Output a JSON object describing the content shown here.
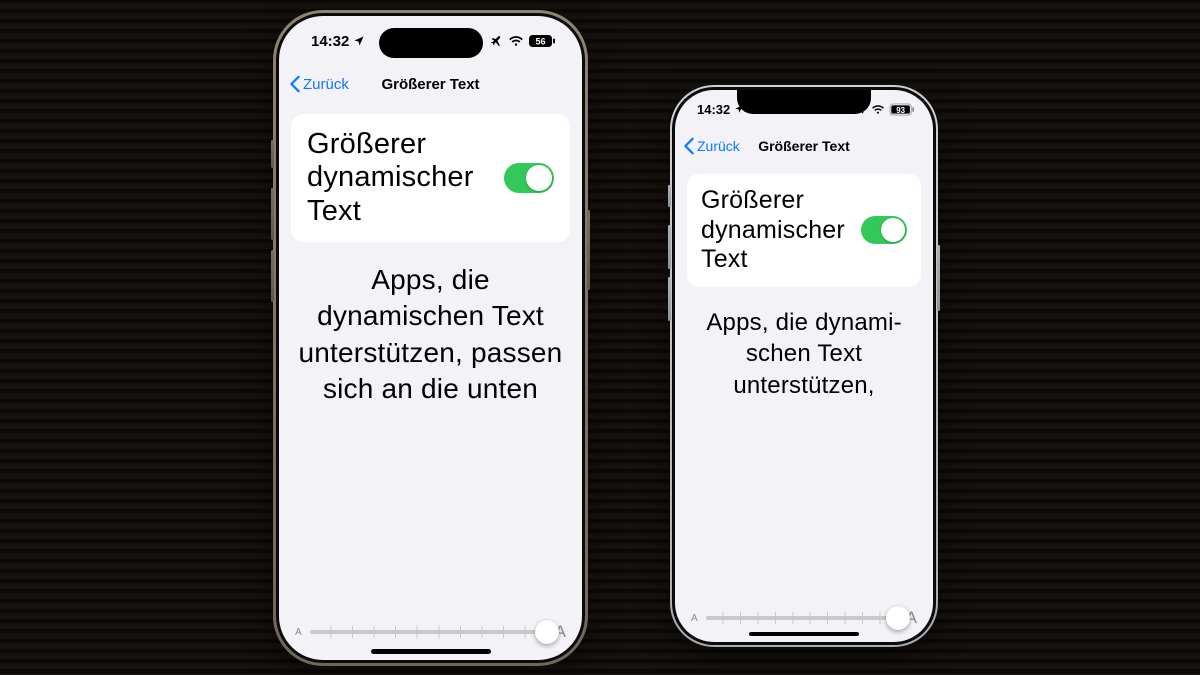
{
  "phones": [
    {
      "model": "iPhone14Pro",
      "status": {
        "time": "14:32",
        "battery": "56"
      },
      "nav": {
        "back": "Zurück",
        "title": "Größerer Text"
      },
      "toggle": {
        "label": "Größerer dynami­scher Text",
        "on": true
      },
      "description": "Apps, die dynamischen Text unterstützen, passen sich an die unten",
      "slider": {
        "small": "A",
        "large": "A",
        "value": 11,
        "steps": 12
      }
    },
    {
      "model": "iPhone13mini",
      "status": {
        "time": "14:32",
        "battery": "93"
      },
      "nav": {
        "back": "Zurück",
        "title": "Größerer Text"
      },
      "toggle": {
        "label": "Größerer dynami­scher Text",
        "on": true
      },
      "description": "Apps, die dynami­schen Text unterstützen,",
      "slider": {
        "small": "A",
        "large": "A",
        "value": 11,
        "steps": 12
      }
    }
  ]
}
